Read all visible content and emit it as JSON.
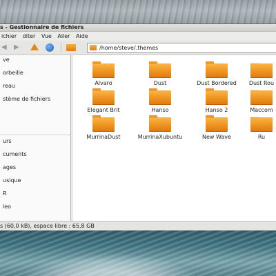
{
  "window": {
    "title": "s - Gestionnaire de fichiers"
  },
  "menubar": {
    "items": [
      {
        "label": "ichier"
      },
      {
        "label": "diter"
      },
      {
        "label": "Vue"
      },
      {
        "label": "Aller"
      },
      {
        "label": "Aide"
      }
    ]
  },
  "toolbar": {
    "back_icon": "back-arrow-icon",
    "forward_icon": "forward-arrow-icon",
    "up_icon": "up-arrow-icon",
    "refresh_icon": "refresh-icon",
    "folder_icon": "folder-icon",
    "path": "/home/steve/.themes"
  },
  "sidebar": {
    "items": [
      {
        "label": "ve"
      },
      {
        "label": "orbeille"
      },
      {
        "label": "reau"
      },
      {
        "label": "stème de fichiers"
      },
      {
        "label": "urs"
      },
      {
        "label": "cuments"
      },
      {
        "label": "ages"
      },
      {
        "label": "usique"
      },
      {
        "label": "R"
      },
      {
        "label": "leo"
      }
    ]
  },
  "content": {
    "folders": [
      {
        "label": "Alvaro"
      },
      {
        "label": "Dust"
      },
      {
        "label": "Dust Bordered"
      },
      {
        "label": "Dust Rou"
      },
      {
        "label": "Elegant Brit"
      },
      {
        "label": "Hanso"
      },
      {
        "label": "Hanso 2"
      },
      {
        "label": "Maccom"
      },
      {
        "label": "MurrinaDust"
      },
      {
        "label": "MurrinaXubuntu"
      },
      {
        "label": "New Wave"
      },
      {
        "label": "Ru"
      }
    ]
  },
  "statusbar": {
    "text": "s (60,0 kB), espace libre : 65,8 GB"
  },
  "colors": {
    "folder": "#f19a26",
    "refresh": "#1f5fb8"
  }
}
